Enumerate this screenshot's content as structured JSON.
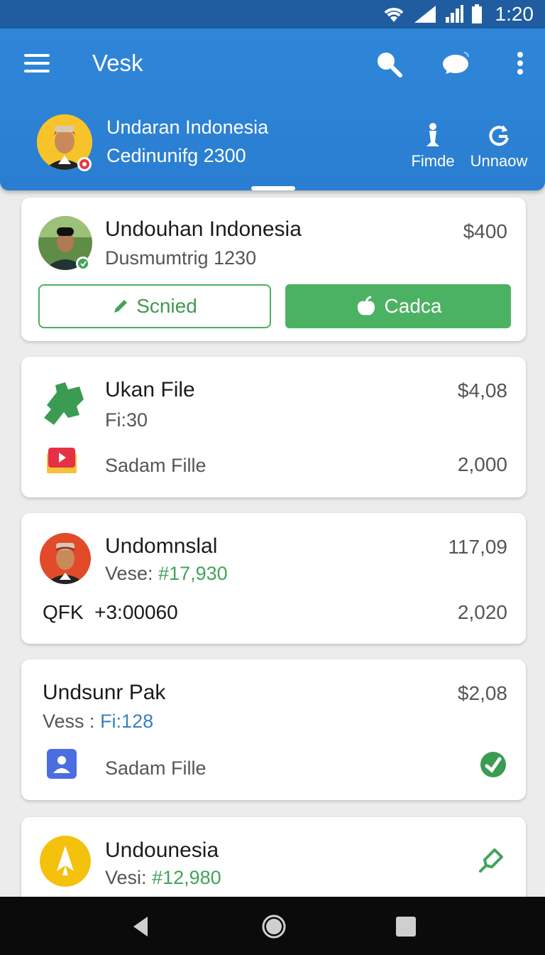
{
  "status_bar": {
    "time": "1:20",
    "icons": [
      "wifi-icon",
      "signal-icon",
      "signal-icon",
      "battery-icon"
    ]
  },
  "app_bar": {
    "title": "Vesk",
    "actions": [
      "search-icon",
      "chat-icon",
      "more-icon"
    ],
    "profile": {
      "name": "Undaran Indonesia",
      "subtitle": "Cedinunifg 2300"
    },
    "quick_actions": [
      {
        "label": "Fimde",
        "icon": "chess-pawn-icon"
      },
      {
        "label": "Unnaow",
        "icon": "refresh-icon"
      }
    ]
  },
  "cards": [
    {
      "title": "Undouhan Indonesia",
      "subtitle": "Dusmumtrig 1230",
      "amount": "$400",
      "buttons": {
        "outline": "Scnied",
        "filled": "Cadca"
      }
    },
    {
      "title": "Ukan File",
      "subtitle": "Fi:30",
      "amount": "$4,08",
      "row_label": "Sadam Fille",
      "row_value": "2,000"
    },
    {
      "title": "Undomnslal",
      "subtitle_label": "Vese:",
      "subtitle_value": "#17,930",
      "amount": "117,09",
      "row_label": "QFK",
      "row_code": "+3:00060",
      "row_value": "2,020"
    },
    {
      "title": "Undsunr Pak",
      "subtitle_label": "Vess :",
      "subtitle_value": "Fi:128",
      "amount": "$2,08",
      "row_label": "Sadam Fille"
    },
    {
      "title": "Undounesia",
      "subtitle_label": "Vesi:",
      "subtitle_value": "#12,980"
    }
  ],
  "colors": {
    "primary": "#2a7ed1",
    "status_bar": "#1f5da0",
    "accent_green": "#4cb263",
    "red_value": "#c2284a",
    "blue_text": "#3a7fc4"
  },
  "nav_bar": [
    "back-icon",
    "home-icon",
    "recents-icon"
  ]
}
